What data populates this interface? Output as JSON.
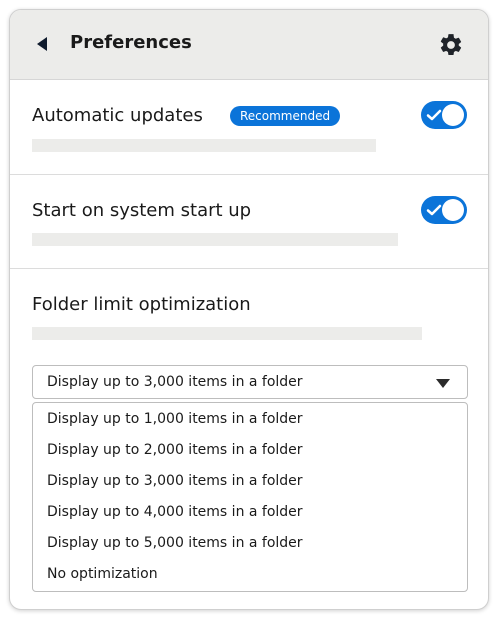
{
  "header": {
    "title": "Preferences",
    "back_icon": "back-arrow-icon",
    "settings_icon": "gear-icon"
  },
  "settings": [
    {
      "title": "Automatic updates",
      "badge": "Recommended",
      "toggle_on": true
    },
    {
      "title": "Start on system start up",
      "toggle_on": true
    },
    {
      "title": "Folder limit optimization"
    }
  ],
  "folder_limit": {
    "selected": "Display up to 3,000 items in a folder",
    "options": [
      "Display up to 1,000 items in a folder",
      "Display up to 2,000 items in a folder",
      "Display up to 3,000 items in a folder",
      "Display up to 4,000 items in a folder",
      "Display up to 5,000 items in a folder",
      "No optimization"
    ]
  },
  "colors": {
    "accent": "#0b74d9",
    "header_bg": "#ececea",
    "placeholder": "#ececea"
  }
}
